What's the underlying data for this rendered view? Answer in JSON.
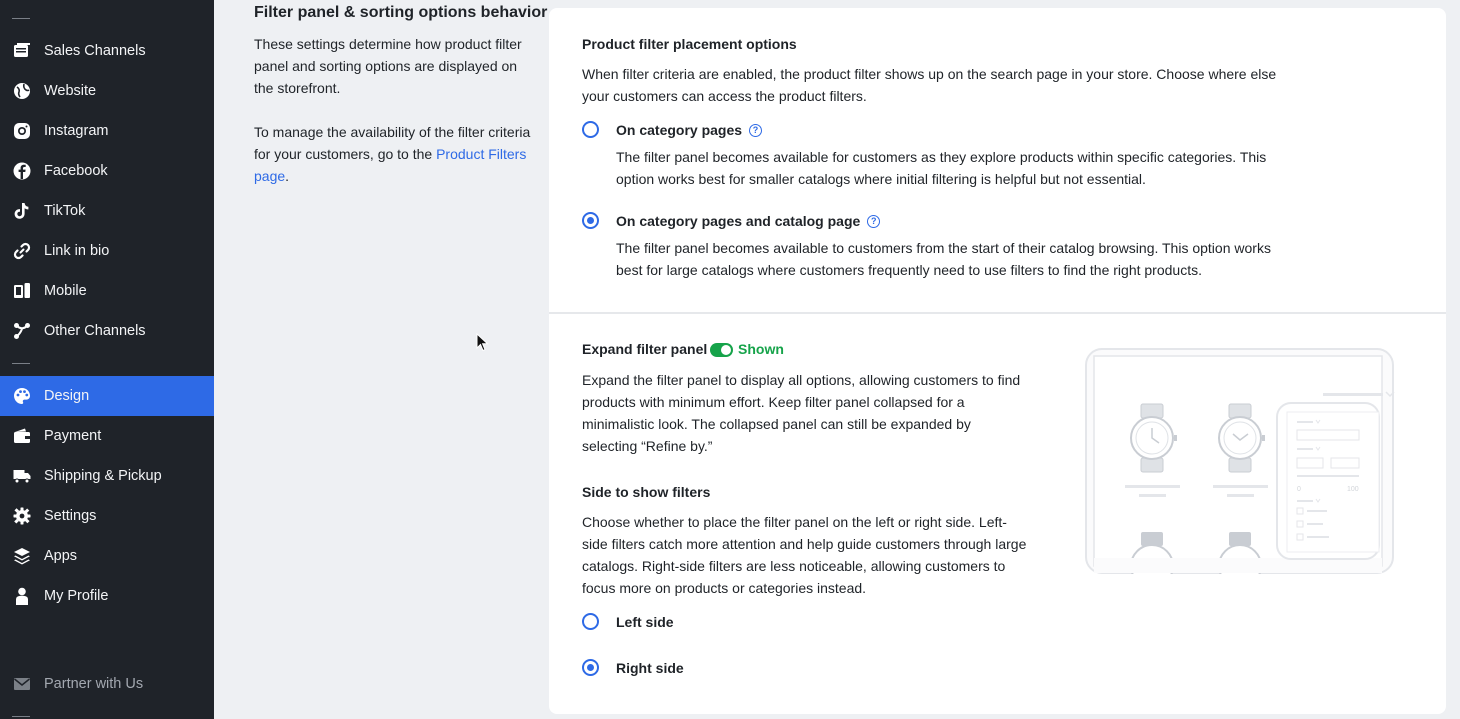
{
  "sidebar": {
    "items": [
      {
        "label": "Sales Channels",
        "icon": "sales-channels-icon"
      },
      {
        "label": "Website",
        "icon": "globe-icon"
      },
      {
        "label": "Instagram",
        "icon": "instagram-icon"
      },
      {
        "label": "Facebook",
        "icon": "facebook-icon"
      },
      {
        "label": "TikTok",
        "icon": "tiktok-icon"
      },
      {
        "label": "Link in bio",
        "icon": "link-icon"
      },
      {
        "label": "Mobile",
        "icon": "mobile-icon"
      },
      {
        "label": "Other Channels",
        "icon": "other-channels-icon"
      },
      {
        "label": "Design",
        "icon": "palette-icon",
        "active": true
      },
      {
        "label": "Payment",
        "icon": "wallet-icon"
      },
      {
        "label": "Shipping & Pickup",
        "icon": "truck-icon"
      },
      {
        "label": "Settings",
        "icon": "gear-icon"
      },
      {
        "label": "Apps",
        "icon": "layers-icon"
      },
      {
        "label": "My Profile",
        "icon": "user-icon"
      }
    ],
    "partner_label": "Partner with Us",
    "accent": "#2e6ae6",
    "background": "#1f2329"
  },
  "section": {
    "title": "Filter panel & sorting options behavior",
    "desc1": "These settings determine how product filter panel and sorting options are displayed on the storefront.",
    "desc2_prefix": "To manage the availability of the filter criteria for your customers, go to the ",
    "desc2_link": "Product Filters page",
    "desc2_suffix": "."
  },
  "placement": {
    "title": "Product filter placement options",
    "description": "When filter criteria are enabled, the product filter shows up on the search page in your store. Choose where else your customers can access the product filters.",
    "options": [
      {
        "label": "On category pages",
        "description": "The filter panel becomes available for customers as they explore products within specific categories. This option works best for smaller catalogs where initial filtering is helpful but not essential.",
        "selected": false
      },
      {
        "label": "On category pages and catalog page",
        "description": "The filter panel becomes available to customers from the start of their catalog browsing. This option works best for large catalogs where customers frequently need to use filters to find the right products.",
        "selected": true
      }
    ]
  },
  "expand": {
    "title": "Expand filter panel",
    "toggle_state": "Shown",
    "toggle_on": true,
    "description": "Expand the filter panel to display all options, allowing customers to find products with minimum effort. Keep filter panel collapsed for a minimalistic look. The collapsed panel can still be expanded by selecting “Refine by.”"
  },
  "side": {
    "title": "Side to show filters",
    "description": "Choose whether to place the filter panel on the left or right side. Left-side filters catch more attention and help guide customers through large catalogs. Right-side filters are less noticeable, allowing customers to focus more on products or categories instead.",
    "options": [
      {
        "label": "Left side",
        "selected": false
      },
      {
        "label": "Right side",
        "selected": true
      }
    ]
  },
  "illustration": {
    "range_min": "0",
    "range_max": "100"
  },
  "colors": {
    "accent": "#2e6ae6",
    "success": "#16a34a"
  }
}
